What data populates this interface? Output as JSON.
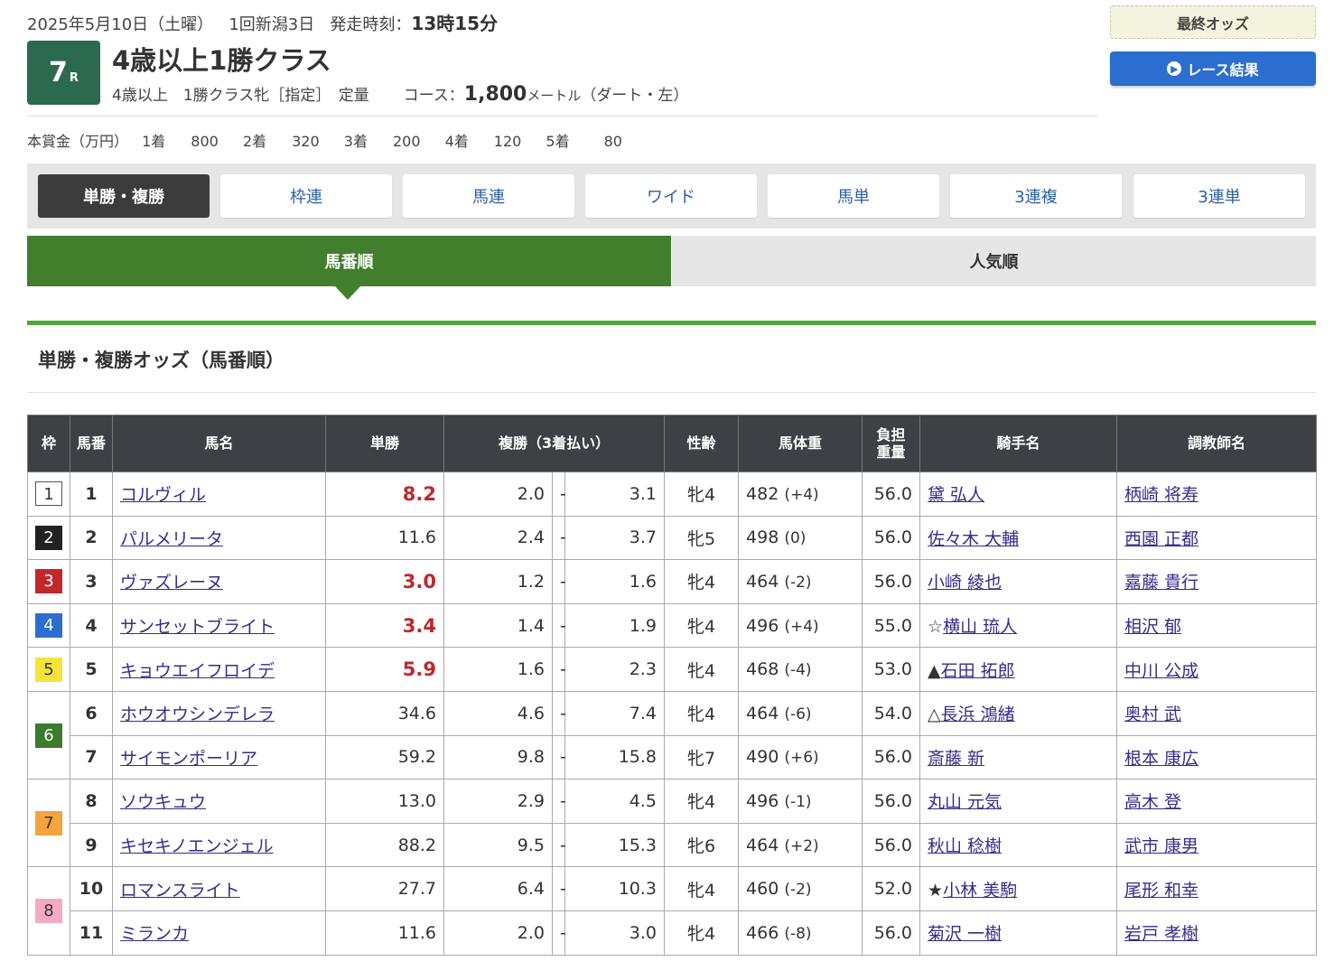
{
  "header": {
    "date": "2025年5月10日（土曜）",
    "meeting": "1回新潟3日",
    "start_label": "発走時刻：",
    "start_time": "13時15分",
    "race_number": "7",
    "race_suffix": "R",
    "title": "4歳以上1勝クラス",
    "conditions": "4歳以上　1勝クラス牝［指定］　定量",
    "course_label": "コース：",
    "distance": "1,800",
    "distance_unit": "メートル",
    "surface": "（ダート・左）"
  },
  "prize": {
    "label": "本賞金（万円）",
    "items": [
      {
        "place": "1着",
        "amount": "800"
      },
      {
        "place": "2着",
        "amount": "320"
      },
      {
        "place": "3着",
        "amount": "200"
      },
      {
        "place": "4着",
        "amount": "120"
      },
      {
        "place": "5着",
        "amount": "80"
      }
    ]
  },
  "buttons": {
    "final_odds": "最終オッズ",
    "race_result": "レース結果"
  },
  "bet_tabs": [
    "単勝・複勝",
    "枠連",
    "馬連",
    "ワイド",
    "馬単",
    "3連複",
    "3連単"
  ],
  "sort_tabs": {
    "by_number": "馬番順",
    "by_popularity": "人気順"
  },
  "section_title": "単勝・複勝オッズ（馬番順）",
  "table": {
    "headers": {
      "waku": "枠",
      "umaban": "馬番",
      "name": "馬名",
      "win": "単勝",
      "place": "複勝（3着払い）",
      "sex_age": "性齢",
      "weight": "馬体重",
      "burden1": "負担",
      "burden2": "重量",
      "jockey": "騎手名",
      "trainer": "調教師名"
    },
    "rows": [
      {
        "waku": "1",
        "num": "1",
        "name": "コルヴィル",
        "win": "8.2",
        "pmin": "2.0",
        "pmax": "3.1",
        "sex": "牝4",
        "wt": "482",
        "wd": "(+4)",
        "kin": "56.0",
        "mark": "",
        "jockey": "黛 弘人",
        "trainer": "柄崎 将寿"
      },
      {
        "waku": "2",
        "num": "2",
        "name": "パルメリータ",
        "win": "11.6",
        "pmin": "2.4",
        "pmax": "3.7",
        "sex": "牝5",
        "wt": "498",
        "wd": "(0)",
        "kin": "56.0",
        "mark": "",
        "jockey": "佐々木 大輔",
        "trainer": "西園 正都"
      },
      {
        "waku": "3",
        "num": "3",
        "name": "ヴァズレーヌ",
        "win": "3.0",
        "pmin": "1.2",
        "pmax": "1.6",
        "sex": "牝4",
        "wt": "464",
        "wd": "(-2)",
        "kin": "56.0",
        "mark": "",
        "jockey": "小崎 綾也",
        "trainer": "嘉藤 貴行"
      },
      {
        "waku": "4",
        "num": "4",
        "name": "サンセットブライト",
        "win": "3.4",
        "pmin": "1.4",
        "pmax": "1.9",
        "sex": "牝4",
        "wt": "496",
        "wd": "(+4)",
        "kin": "55.0",
        "mark": "☆",
        "jockey": "横山 琉人",
        "trainer": "相沢 郁"
      },
      {
        "waku": "5",
        "num": "5",
        "name": "キョウエイフロイデ",
        "win": "5.9",
        "pmin": "1.6",
        "pmax": "2.3",
        "sex": "牝4",
        "wt": "468",
        "wd": "(-4)",
        "kin": "53.0",
        "mark": "▲",
        "jockey": "石田 拓郎",
        "trainer": "中川 公成"
      },
      {
        "waku": "6",
        "num": "6",
        "name": "ホウオウシンデレラ",
        "win": "34.6",
        "pmin": "4.6",
        "pmax": "7.4",
        "sex": "牝4",
        "wt": "464",
        "wd": "(-6)",
        "kin": "54.0",
        "mark": "△",
        "jockey": "長浜 鴻緒",
        "trainer": "奥村 武"
      },
      {
        "waku": "",
        "num": "7",
        "name": "サイモンポーリア",
        "win": "59.2",
        "pmin": "9.8",
        "pmax": "15.8",
        "sex": "牝7",
        "wt": "490",
        "wd": "(+6)",
        "kin": "56.0",
        "mark": "",
        "jockey": "斎藤 新",
        "trainer": "根本 康広"
      },
      {
        "waku": "7",
        "num": "8",
        "name": "ソウキュウ",
        "win": "13.0",
        "pmin": "2.9",
        "pmax": "4.5",
        "sex": "牝4",
        "wt": "496",
        "wd": "(-1)",
        "kin": "56.0",
        "mark": "",
        "jockey": "丸山 元気",
        "trainer": "高木 登"
      },
      {
        "waku": "",
        "num": "9",
        "name": "キセキノエンジェル",
        "win": "88.2",
        "pmin": "9.5",
        "pmax": "15.3",
        "sex": "牝6",
        "wt": "464",
        "wd": "(+2)",
        "kin": "56.0",
        "mark": "",
        "jockey": "秋山 稔樹",
        "trainer": "武市 康男"
      },
      {
        "waku": "8",
        "num": "10",
        "name": "ロマンスライト",
        "win": "27.7",
        "pmin": "6.4",
        "pmax": "10.3",
        "sex": "牝4",
        "wt": "460",
        "wd": "(-2)",
        "kin": "52.0",
        "mark": "★",
        "jockey": "小林 美駒",
        "trainer": "尾形 和幸"
      },
      {
        "waku": "",
        "num": "11",
        "name": "ミランカ",
        "win": "11.6",
        "pmin": "2.0",
        "pmax": "3.0",
        "sex": "牝4",
        "wt": "466",
        "wd": "(-8)",
        "kin": "56.0",
        "mark": "",
        "jockey": "菊沢 一樹",
        "trainer": "岩戸 孝樹"
      }
    ]
  },
  "colors": {
    "waku_1": "#ffffff",
    "waku_2": "#222222",
    "waku_3": "#c0282b",
    "waku_4": "#2b6ed0",
    "waku_5": "#f5e33a",
    "waku_6": "#3c7a2e",
    "waku_7": "#f4a43a",
    "waku_8": "#f4a9c4",
    "hot_odds": "#c0282b",
    "accent_green": "#427f2c",
    "link": "#3b2a8c"
  }
}
